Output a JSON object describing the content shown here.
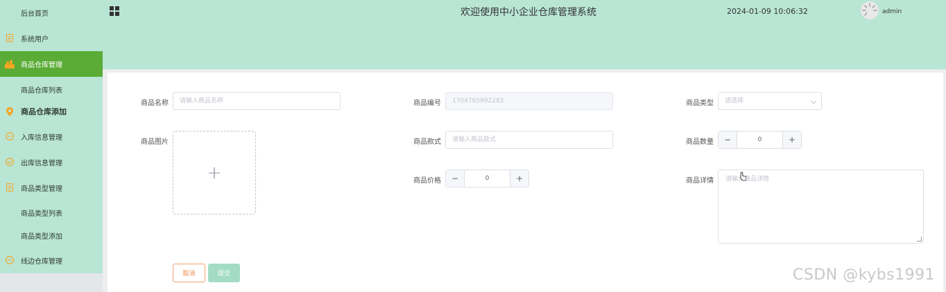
{
  "sidebar": {
    "items": [
      {
        "label": "后台首页",
        "icon": "none"
      },
      {
        "label": "系统用户",
        "icon": "document-icon"
      },
      {
        "label": "商品仓库管理",
        "icon": "warehouse-icon"
      },
      {
        "label": "商品仓库列表",
        "icon": "none"
      },
      {
        "label": "商品仓库添加",
        "icon": "location-pin-icon"
      },
      {
        "label": "入库信息管理",
        "icon": "chat-bubble-icon"
      },
      {
        "label": "出库信息管理",
        "icon": "check-circle-icon"
      },
      {
        "label": "商品类型管理",
        "icon": "document-icon"
      },
      {
        "label": "商品类型列表",
        "icon": "none"
      },
      {
        "label": "商品类型添加",
        "icon": "none"
      },
      {
        "label": "线边仓库管理",
        "icon": "chat-bubble-icon"
      }
    ]
  },
  "header": {
    "title": "欢迎使用中小企业仓库管理系统",
    "datetime": "2024-01-09 10:06:32",
    "username": "admin"
  },
  "form": {
    "name": {
      "label": "商品名称",
      "placeholder": "请输入商品名称"
    },
    "code": {
      "label": "商品编号",
      "value": "1704765992282"
    },
    "type": {
      "label": "商品类型",
      "placeholder": "请选择"
    },
    "image": {
      "label": "商品图片"
    },
    "style": {
      "label": "商品款式",
      "placeholder": "请输入商品款式"
    },
    "quantity": {
      "label": "商品数量",
      "value": "0"
    },
    "price": {
      "label": "商品价格",
      "value": "0"
    },
    "detail": {
      "label": "商品详情",
      "placeholder": "请输入商品详情"
    },
    "cancel_label": "取消",
    "submit_label": "提交"
  },
  "watermark": "CSDN @kybs1991",
  "colors": {
    "sidebar_bg": "#b9e5d4",
    "active_bg": "#5aac36",
    "accent_icon": "#f5a623",
    "submit_bg": "#a3dcc4",
    "cancel_border": "#f0a070"
  }
}
